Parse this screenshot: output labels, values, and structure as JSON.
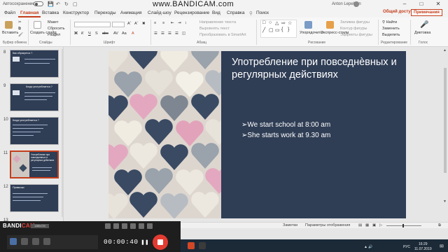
{
  "watermark": "www.BANDICAM.com",
  "titlebar": {
    "autosave": "Автосохранение",
    "user": "Anton Lepekhin"
  },
  "tabs": [
    {
      "label": "Файл",
      "active": false
    },
    {
      "label": "Главная",
      "active": true
    },
    {
      "label": "Вставка",
      "active": false
    },
    {
      "label": "Конструктор",
      "active": false
    },
    {
      "label": "Переходы",
      "active": false
    },
    {
      "label": "Анимация",
      "active": false
    },
    {
      "label": "Слайд-шоу",
      "active": false
    },
    {
      "label": "Рецензирование",
      "active": false
    },
    {
      "label": "Вид",
      "active": false
    },
    {
      "label": "Справка",
      "active": false
    },
    {
      "label": "Поиск",
      "active": false
    }
  ],
  "share_label": "Общий доступ",
  "comments_label": "Примечания",
  "ribbon": {
    "paste": "Вставить",
    "create_slide": "Создать слайд",
    "layout": "Макет",
    "reset": "Сбросить",
    "section": "Раздел",
    "text_direction": "Направление текста",
    "align_text": "Выровнять текст",
    "smartart": "Преобразовать в SmartArt",
    "arrange": "Упорядочить",
    "quick_styles": "Экспресс-стили",
    "shape_fill": "Заливка фигуры",
    "shape_outline": "Контур фигуры",
    "shape_effects": "Эффекты фигуры",
    "find": "Найти",
    "replace": "Заменить",
    "select": "Выделить",
    "dictation": "Диктовка",
    "groups": {
      "clipboard": "Буфер обмена",
      "slides": "Слайды",
      "font": "Шрифт",
      "paragraph": "Абзац",
      "drawing": "Рисование",
      "editing": "Редактирование",
      "voice": "Голос"
    }
  },
  "thumbnails": [
    {
      "num": "8",
      "title": "Как образуется ?",
      "selected": false
    },
    {
      "num": "9",
      "title": "Когда употребляется ?",
      "selected": false
    },
    {
      "num": "10",
      "title": "Когда употребляется ?",
      "selected": false
    },
    {
      "num": "11",
      "title": "Употребление при повседневных и регулярных действиях",
      "selected": true
    },
    {
      "num": "12",
      "title": "Привычки",
      "selected": false
    },
    {
      "num": "13",
      "title": "",
      "selected": false
    }
  ],
  "slide": {
    "title": "Употребление при повседнѐвных и регулярных действиях",
    "bullet_marker": "➢",
    "bullets": [
      "We start school at 8:00 am",
      "She starts work at 9.30 am"
    ]
  },
  "status": {
    "notes": "Заметки",
    "display": "Параметры отображения"
  },
  "bandicam": {
    "logo_a": "BANDI",
    "logo_b": "CAM",
    "resolution": "1280x720",
    "timer": "00:00:40"
  },
  "tray": {
    "lang": "РУС",
    "time": "16:29",
    "date": "11.07.2019"
  }
}
